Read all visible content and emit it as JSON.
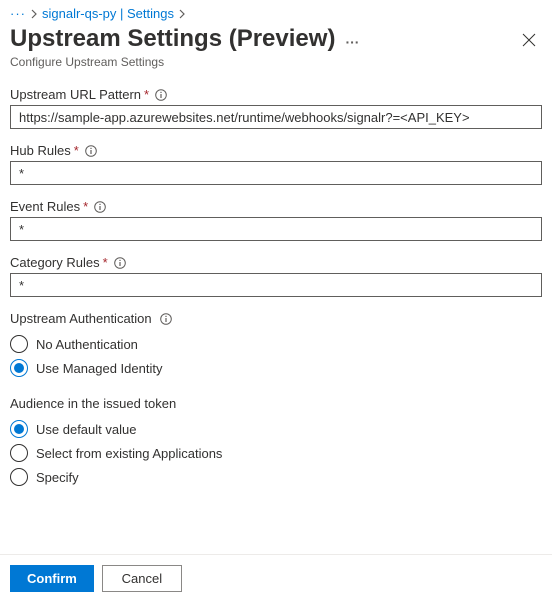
{
  "breadcrumb": {
    "item1": "signalr-qs-py | Settings"
  },
  "header": {
    "title": "Upstream Settings (Preview)",
    "subtitle": "Configure Upstream Settings"
  },
  "fields": {
    "url_pattern": {
      "label": "Upstream URL Pattern",
      "value": "https://sample-app.azurewebsites.net/runtime/webhooks/signalr?=<API_KEY>"
    },
    "hub_rules": {
      "label": "Hub Rules",
      "value": "*"
    },
    "event_rules": {
      "label": "Event Rules",
      "value": "*"
    },
    "category_rules": {
      "label": "Category Rules",
      "value": "*"
    }
  },
  "auth": {
    "label": "Upstream Authentication",
    "options": {
      "none": "No Authentication",
      "managed": "Use Managed Identity"
    }
  },
  "audience": {
    "label": "Audience in the issued token",
    "options": {
      "default": "Use default value",
      "existing": "Select from existing Applications",
      "specify": "Specify"
    }
  },
  "footer": {
    "confirm": "Confirm",
    "cancel": "Cancel"
  }
}
